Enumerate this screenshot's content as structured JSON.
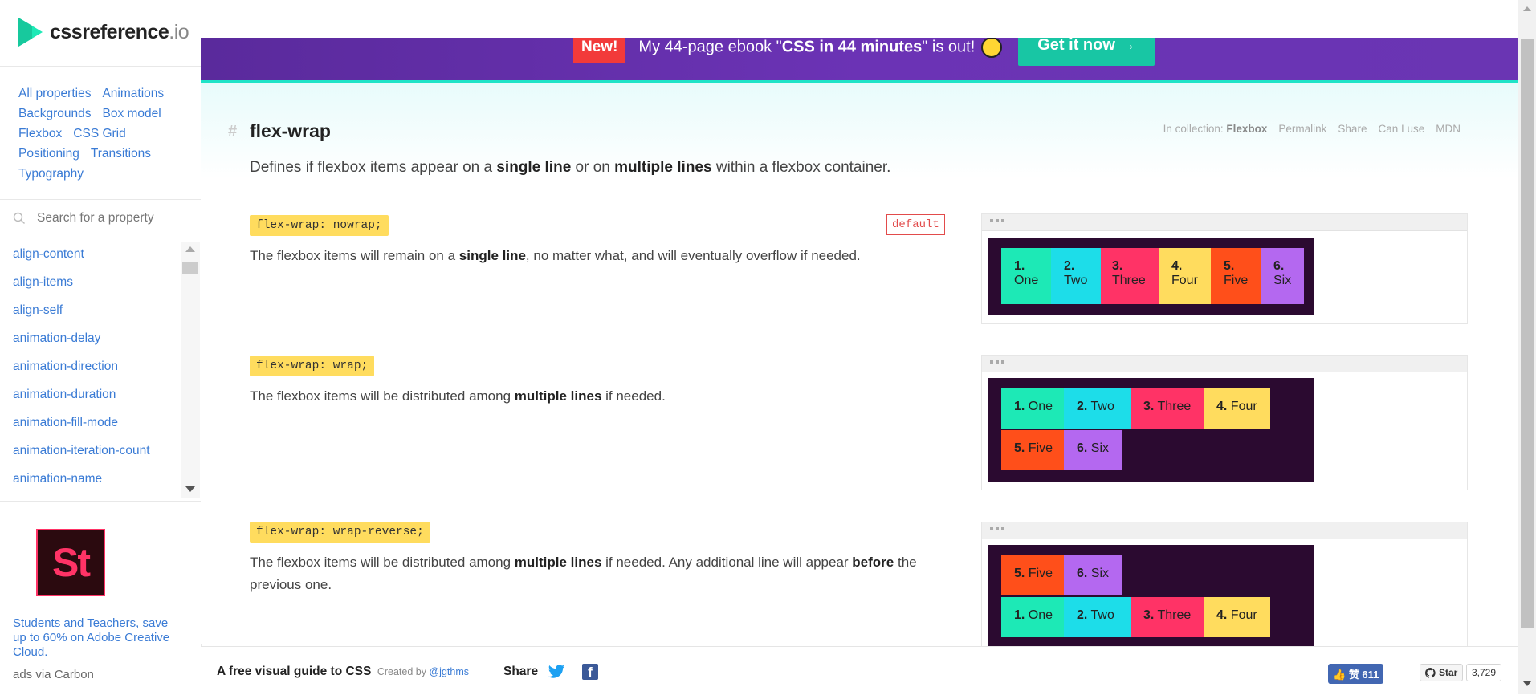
{
  "brand": {
    "name": "cssreference",
    "tld": ".io"
  },
  "categories": [
    "All properties",
    "Animations",
    "Backgrounds",
    "Box model",
    "Flexbox",
    "CSS Grid",
    "Positioning",
    "Transitions",
    "Typography"
  ],
  "search": {
    "placeholder": "Search for a property",
    "icon": "search-icon"
  },
  "properties": [
    "align-content",
    "align-items",
    "align-self",
    "animation-delay",
    "animation-direction",
    "animation-duration",
    "animation-fill-mode",
    "animation-iteration-count",
    "animation-name"
  ],
  "ad": {
    "logo_text": "St",
    "text": "Students and Teachers, save up to 60% on Adobe Creative Cloud.",
    "via": "ads via Carbon"
  },
  "banner": {
    "badge": "New!",
    "text_pre": "My 44-page ebook \"",
    "text_bold": "CSS in 44 minutes",
    "text_post": "\" is out!",
    "cta": "Get it now →"
  },
  "property": {
    "hash": "#",
    "name": "flex-wrap",
    "meta": {
      "collection_label": "In collection:",
      "collection": "Flexbox",
      "permalink": "Permalink",
      "share": "Share",
      "caniuse": "Can I use",
      "mdn": "MDN"
    },
    "description": {
      "parts": [
        {
          "t": "Defines if flexbox items appear on a "
        },
        {
          "t": "single line",
          "b": true
        },
        {
          "t": " or on "
        },
        {
          "t": "multiple lines",
          "b": true
        },
        {
          "t": " within a flexbox container."
        }
      ]
    }
  },
  "examples": [
    {
      "code": "flex-wrap: nowrap;",
      "badge": "default",
      "description": [
        {
          "t": "The flexbox items will remain on a "
        },
        {
          "t": "single line",
          "b": true
        },
        {
          "t": ", no matter what, and will eventually overflow if needed."
        }
      ],
      "items": [
        {
          "num": "1.",
          "label": "One",
          "color": "#1de9b6"
        },
        {
          "num": "2.",
          "label": "Two",
          "color": "#1ddde9"
        },
        {
          "num": "3.",
          "label": "Three",
          "color": "#ff3366"
        },
        {
          "num": "4.",
          "label": "Four",
          "color": "#ffdc5e"
        },
        {
          "num": "5.",
          "label": "Five",
          "color": "#ff4f1a"
        },
        {
          "num": "6.",
          "label": "Six",
          "color": "#b468f0"
        }
      ]
    },
    {
      "code": "flex-wrap: wrap;",
      "description": [
        {
          "t": "The flexbox items will be distributed among "
        },
        {
          "t": "multiple lines",
          "b": true
        },
        {
          "t": " if needed."
        }
      ],
      "items": [
        {
          "num": "1.",
          "label": "One",
          "color": "#1de9b6"
        },
        {
          "num": "2.",
          "label": "Two",
          "color": "#1ddde9"
        },
        {
          "num": "3.",
          "label": "Three",
          "color": "#ff3366"
        },
        {
          "num": "4.",
          "label": "Four",
          "color": "#ffdc5e"
        },
        {
          "num": "5.",
          "label": "Five",
          "color": "#ff4f1a"
        },
        {
          "num": "6.",
          "label": "Six",
          "color": "#b468f0"
        }
      ]
    },
    {
      "code": "flex-wrap: wrap-reverse;",
      "description": [
        {
          "t": "The flexbox items will be distributed among "
        },
        {
          "t": "multiple lines",
          "b": true
        },
        {
          "t": " if needed. Any additional line will appear "
        },
        {
          "t": "before",
          "b": true
        },
        {
          "t": " the previous one."
        }
      ],
      "items": [
        {
          "num": "5.",
          "label": "Five",
          "color": "#ff4f1a"
        },
        {
          "num": "6.",
          "label": "Six",
          "color": "#b468f0"
        },
        {
          "num": "1.",
          "label": "One",
          "color": "#1de9b6"
        },
        {
          "num": "2.",
          "label": "Two",
          "color": "#1ddde9"
        },
        {
          "num": "3.",
          "label": "Three",
          "color": "#ff3366"
        },
        {
          "num": "4.",
          "label": "Four",
          "color": "#ffdc5e"
        }
      ]
    }
  ],
  "footer": {
    "guide": "A free visual guide to CSS",
    "created_by": "Created by",
    "author": "@jgthms",
    "share": "Share",
    "like": "赞 611",
    "star": "Star",
    "star_count": "3,729"
  }
}
